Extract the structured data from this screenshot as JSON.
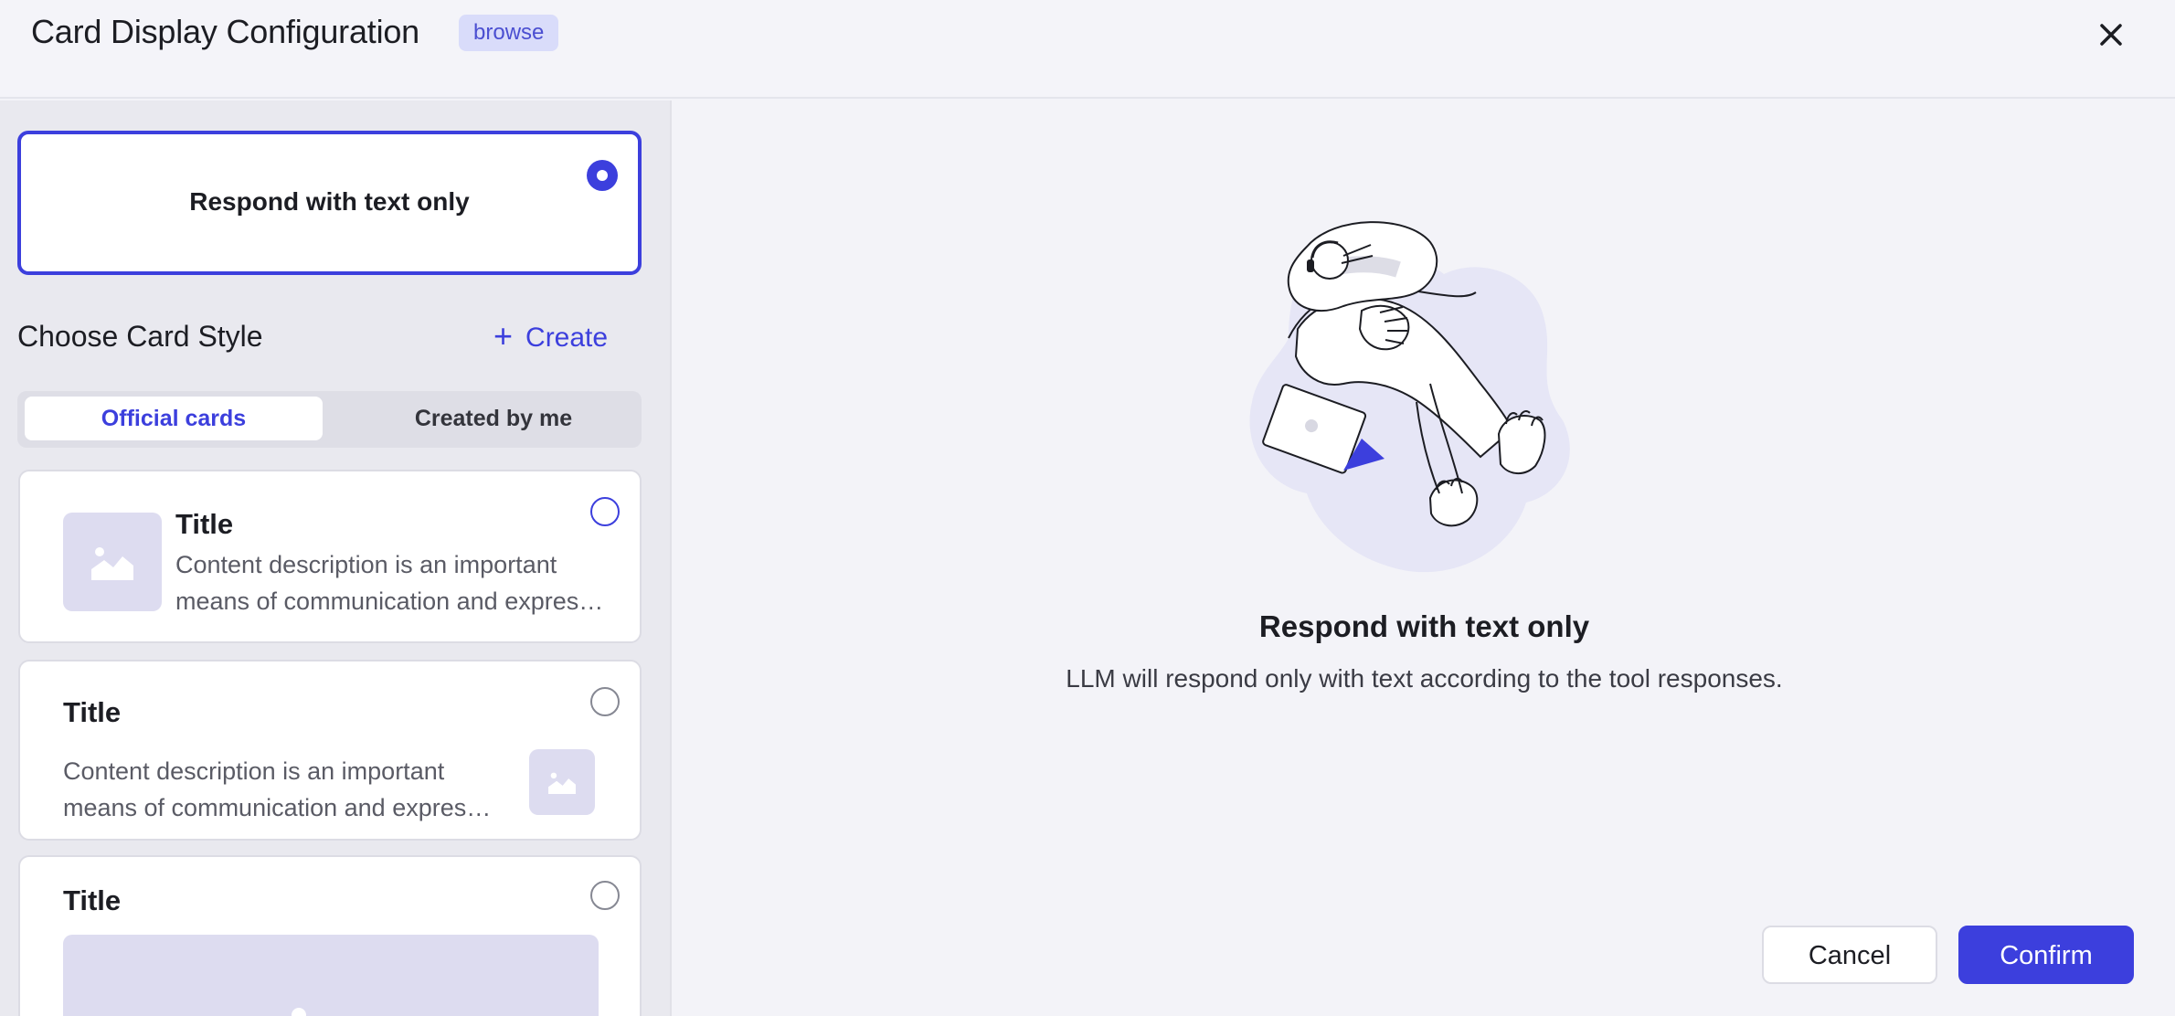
{
  "dialog": {
    "title": "Card Display Configuration",
    "badge": "browse",
    "close_icon": "close-icon"
  },
  "sidebar": {
    "text_only_option": {
      "label": "Respond with text only",
      "selected": true
    },
    "section_title": "Choose Card Style",
    "create_label": "Create",
    "tabs": [
      {
        "label": "Official cards",
        "active": true
      },
      {
        "label": "Created by me",
        "active": false
      }
    ],
    "cards": [
      {
        "title": "Title",
        "desc_line1": "Content description is an important",
        "desc_line2": "means of communication and express...",
        "layout": "image-left"
      },
      {
        "title": "Title",
        "desc_line1": "Content description is an important",
        "desc_line2": "means of communication and expressi...",
        "layout": "image-right"
      },
      {
        "title": "Title",
        "layout": "image-bottom"
      }
    ]
  },
  "preview": {
    "title": "Respond with text only",
    "description": "LLM will respond only with text according to the tool responses."
  },
  "footer": {
    "cancel_label": "Cancel",
    "confirm_label": "Confirm"
  },
  "colors": {
    "accent": "#3c3fdd",
    "badge_bg": "#d9dcfa",
    "thumb_bg": "#dddcf0"
  }
}
